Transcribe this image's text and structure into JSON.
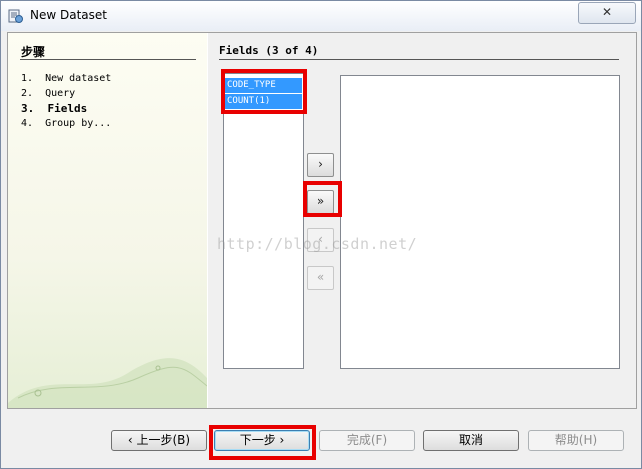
{
  "window": {
    "title": "New Dataset",
    "close_label": "✕"
  },
  "steps": {
    "title": "步骤",
    "items": [
      {
        "label": "1.  New dataset",
        "current": false
      },
      {
        "label": "2.  Query",
        "current": false
      },
      {
        "label": "3.  Fields",
        "current": true
      },
      {
        "label": "4.  Group by...",
        "current": false
      }
    ]
  },
  "fields": {
    "title": "Fields (3 of 4)",
    "available": [
      "CODE_TYPE",
      "COUNT(1)"
    ],
    "selected": []
  },
  "arrows": {
    "add_one": "›",
    "add_all": "»",
    "remove_one": "‹",
    "remove_all": "«"
  },
  "watermark": "http://blog.csdn.net/",
  "buttons": {
    "back": "‹ 上一步(B)",
    "next": "下一步 ›",
    "finish": "完成(F)",
    "cancel": "取消",
    "help": "帮助(H)"
  },
  "colors": {
    "selection": "#3399ff",
    "highlight": "#e80000"
  }
}
